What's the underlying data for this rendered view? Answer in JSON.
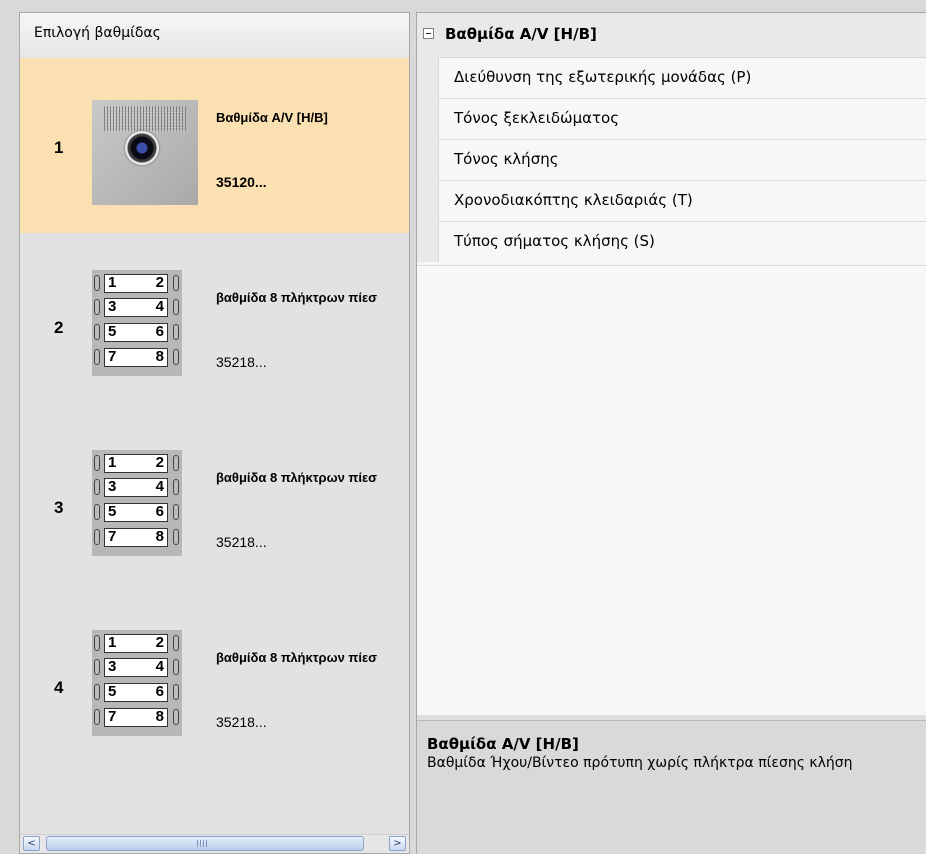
{
  "left_panel": {
    "header": "Επιλογή βαθμίδας",
    "rows": [
      {
        "number": "1",
        "name": "Βαθμίδα A/V [H/B]",
        "code": "35120...",
        "thumbnail": "camera-module-icon"
      },
      {
        "number": "2",
        "name": "βαθμίδα 8 πλήκτρων πίεσ",
        "code": "35218...",
        "thumbnail": "keypad-8-buttons-icon"
      },
      {
        "number": "3",
        "name": "βαθμίδα 8 πλήκτρων πίεσ",
        "code": "35218...",
        "thumbnail": "keypad-8-buttons-icon"
      },
      {
        "number": "4",
        "name": "βαθμίδα 8 πλήκτρων πίεσ",
        "code": "35218...",
        "thumbnail": "keypad-8-buttons-icon"
      }
    ],
    "keypad_labels": [
      [
        "1",
        "2"
      ],
      [
        "3",
        "4"
      ],
      [
        "5",
        "6"
      ],
      [
        "7",
        "8"
      ]
    ],
    "scrollbar": {
      "left_arrow": "<",
      "right_arrow": ">",
      "grip": "|||"
    }
  },
  "property_grid": {
    "category": "Βαθμίδα A/V [H/B]",
    "properties": [
      "Διεύθυνση της εξωτερικής μονάδας (P)",
      "Τόνος ξεκλειδώματος",
      "Τόνος κλήσης",
      "Χρονοδιακόπτης κλειδαριάς (T)",
      "Τύπος σήματος κλήσης (S)"
    ]
  },
  "description": {
    "title": "Βαθμίδα A/V [H/B]",
    "text": "Βαθμίδα Ήχου/Βίντεο πρότυπη χωρίς πλήκτρα πίεσης κλήση"
  },
  "colors": {
    "selected_row": "#fbe1b1",
    "panel_bg": "#e2e2e2",
    "grid_bg": "#f7f7f7"
  }
}
